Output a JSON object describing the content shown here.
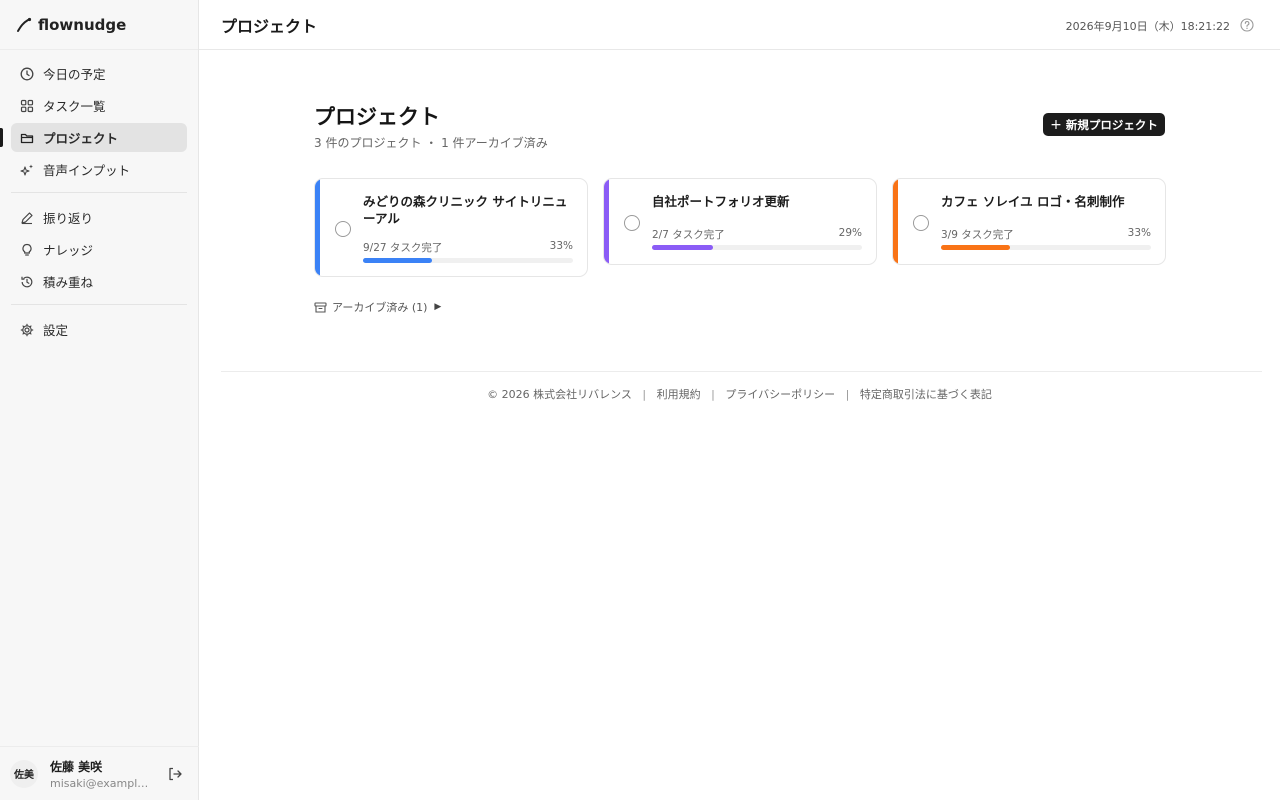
{
  "app": {
    "name": "flownudge"
  },
  "sidebar": {
    "items": [
      {
        "label": "今日の予定",
        "icon": "clock-icon"
      },
      {
        "label": "タスク一覧",
        "icon": "grid-icon"
      },
      {
        "label": "プロジェクト",
        "icon": "folder-icon",
        "active": true
      },
      {
        "label": "音声インプット",
        "icon": "sparkles-icon"
      },
      {
        "label": "振り返り",
        "icon": "pencil-icon"
      },
      {
        "label": "ナレッジ",
        "icon": "lightbulb-icon"
      },
      {
        "label": "積み重ね",
        "icon": "history-icon"
      },
      {
        "label": "設定",
        "icon": "gear-icon"
      }
    ],
    "user": {
      "avatar_text": "佐美",
      "name": "佐藤 美咲",
      "email": "misaki@example.…"
    }
  },
  "header": {
    "title": "プロジェクト",
    "datetime": "2026年9月10日（木）18:21:22"
  },
  "main": {
    "title": "プロジェクト",
    "subtitle": "3 件のプロジェクト ・ 1 件アーカイブ済み",
    "new_button": "新規プロジェクト",
    "projects": [
      {
        "name": "みどりの森クリニック サイトリニューアル",
        "progress_text": "9/27 タスク完了",
        "percent": "33%",
        "progress": 0.33,
        "color": "#3b82f6"
      },
      {
        "name": "自社ポートフォリオ更新",
        "progress_text": "2/7 タスク完了",
        "percent": "29%",
        "progress": 0.29,
        "color": "#8b5cf6"
      },
      {
        "name": "カフェ ソレイユ ロゴ・名刺制作",
        "progress_text": "3/9 タスク完了",
        "percent": "33%",
        "progress": 0.33,
        "color": "#f97316"
      }
    ],
    "archive_toggle": "アーカイブ済み (1)"
  },
  "footer": {
    "copyright": "© 2026 株式会社リバレンス",
    "links": [
      "利用規約",
      "プライバシーポリシー",
      "特定商取引法に基づく表記"
    ],
    "separator": "|"
  }
}
